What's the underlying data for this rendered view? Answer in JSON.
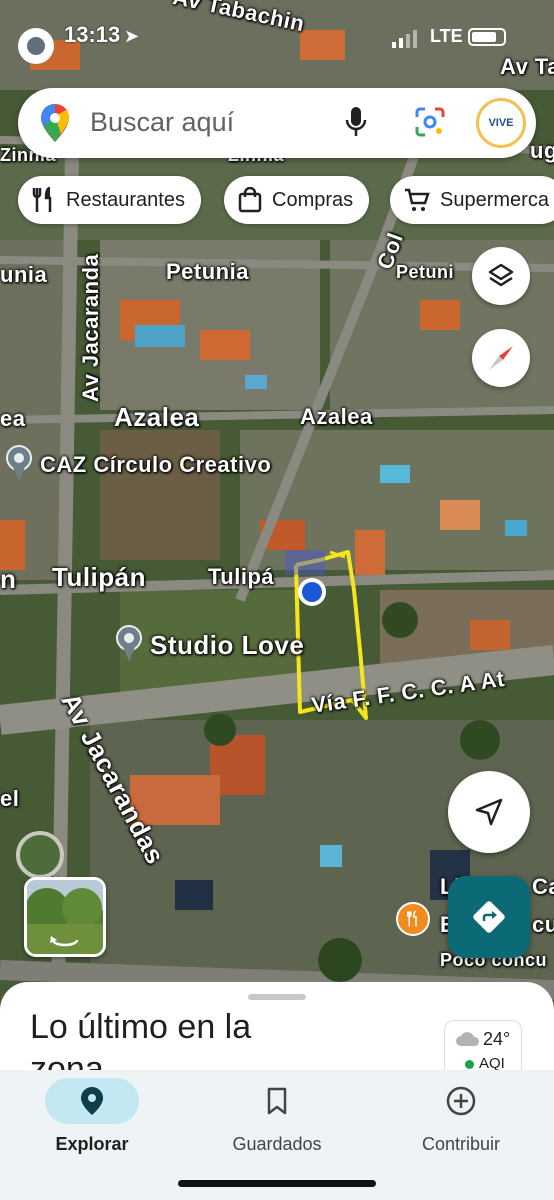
{
  "status_bar": {
    "time": "13:13",
    "network": "LTE"
  },
  "search": {
    "placeholder": "Buscar aquí"
  },
  "account": {
    "avatar_text": "VIVE"
  },
  "chips": [
    {
      "label": "Restaurantes",
      "icon": "fork-knife-icon"
    },
    {
      "label": "Compras",
      "icon": "shopping-bag-icon"
    },
    {
      "label": "Supermerca",
      "icon": "cart-icon"
    }
  ],
  "map_labels": {
    "tabachin": "Av Tabachin",
    "av_ta": "Av Ta",
    "zinnia_left": "Zinnia",
    "zinnia_center": "Zinnia",
    "ug": "ug",
    "petunia_left": "unia",
    "petunia_center": "Petunia",
    "petunia_right": "Petuni",
    "col": "Col",
    "av_jacaranda_v": "Av Jacaranda",
    "azalea_left": "ea",
    "azalea_center": "Azalea",
    "azalea_right": "Azalea",
    "tulipan_left": "n",
    "tulipan_center": "Tulipán",
    "tulipan_right": "Tulipá",
    "via": "Vía F. F. C. C. A At",
    "av_jacarandas": "Av Jacarandas",
    "el": "el",
    "caz": "CAZ Círculo Creativo",
    "studio": "Studio Love",
    "li": "Li",
    "cae": "Cae",
    "e": "E",
    "cu": "cu",
    "poco": "Poco concu"
  },
  "sheet": {
    "title": "Lo último en la zona",
    "weather_temp": "24°",
    "weather_aqi": "AQI"
  },
  "nav": {
    "explore": "Explorar",
    "saved": "Guardados",
    "contribute": "Contribuir"
  },
  "colors": {
    "accent_teal": "#0b6a75",
    "nav_active": "#c4e8f2",
    "annotation_yellow": "#f4e61a",
    "location_blue": "#1a57d6"
  }
}
